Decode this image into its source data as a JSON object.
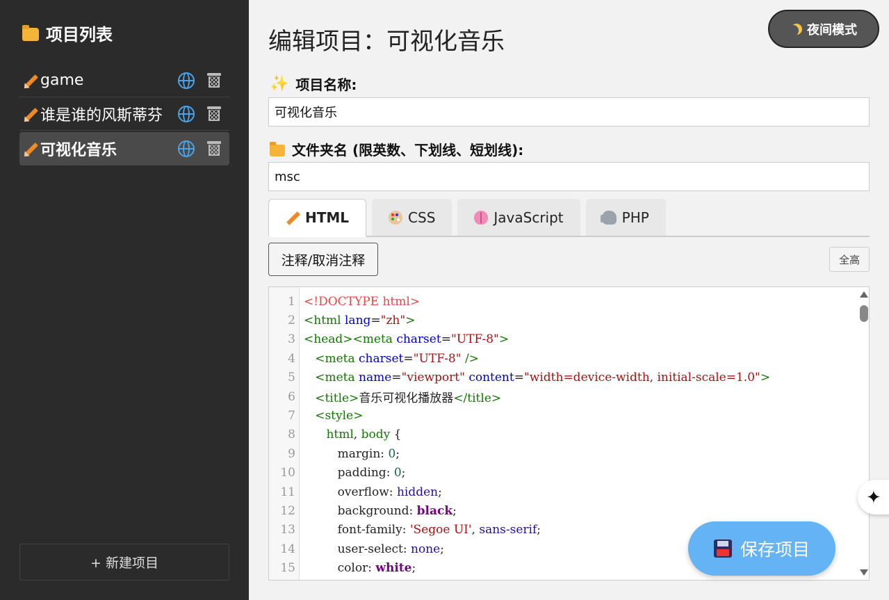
{
  "sidebar": {
    "title": "项目列表",
    "projects": [
      {
        "name": "game"
      },
      {
        "name": "谁是谁的风斯蒂芬"
      },
      {
        "name": "可视化音乐"
      }
    ],
    "new_project": "+ 新建项目"
  },
  "main": {
    "title": "编辑项目：可视化音乐",
    "night_mode": "夜间模式",
    "project_name_label": "项目名称:",
    "project_name_value": "可视化音乐",
    "folder_label": "文件夹名 (限英数、下划线、短划线):",
    "folder_value": "msc",
    "tabs": [
      {
        "label": "HTML",
        "icon": "pencil-icon"
      },
      {
        "label": "CSS",
        "icon": "palette-icon"
      },
      {
        "label": "JavaScript",
        "icon": "brain-icon"
      },
      {
        "label": "PHP",
        "icon": "elephant-icon"
      }
    ],
    "comment_button": "注释/取消注释",
    "full_height_button": "全高",
    "save_button": "保存项目"
  },
  "editor": {
    "lines": [
      {
        "n": "1",
        "tokens": [
          [
            "meta",
            "<!DOCTYPE html>"
          ]
        ]
      },
      {
        "n": "2",
        "tokens": [
          [
            "tag",
            "<html"
          ],
          [
            "plain",
            " "
          ],
          [
            "attr",
            "lang"
          ],
          [
            "plain",
            "="
          ],
          [
            "str",
            "\"zh\""
          ],
          [
            "tag",
            ">"
          ]
        ]
      },
      {
        "n": "3",
        "tokens": [
          [
            "tag",
            "<head><meta"
          ],
          [
            "plain",
            " "
          ],
          [
            "attr",
            "charset"
          ],
          [
            "plain",
            "="
          ],
          [
            "str",
            "\"UTF-8\""
          ],
          [
            "tag",
            ">"
          ]
        ]
      },
      {
        "n": "4",
        "tokens": [
          [
            "plain",
            "   "
          ],
          [
            "tag",
            "<meta"
          ],
          [
            "plain",
            " "
          ],
          [
            "attr",
            "charset"
          ],
          [
            "plain",
            "="
          ],
          [
            "str",
            "\"UTF-8\""
          ],
          [
            "plain",
            " "
          ],
          [
            "tag",
            "/>"
          ]
        ]
      },
      {
        "n": "5",
        "tokens": [
          [
            "plain",
            "   "
          ],
          [
            "tag",
            "<meta"
          ],
          [
            "plain",
            " "
          ],
          [
            "attr",
            "name"
          ],
          [
            "plain",
            "="
          ],
          [
            "str",
            "\"viewport\""
          ],
          [
            "plain",
            " "
          ],
          [
            "attr",
            "content"
          ],
          [
            "plain",
            "="
          ],
          [
            "str",
            "\"width=device-width, initial-scale=1.0\""
          ],
          [
            "tag",
            ">"
          ]
        ]
      },
      {
        "n": "6",
        "tokens": [
          [
            "plain",
            "   "
          ],
          [
            "tag",
            "<title>"
          ],
          [
            "plain",
            "音乐可视化播放器"
          ],
          [
            "tag",
            "</title>"
          ]
        ]
      },
      {
        "n": "7",
        "tokens": [
          [
            "plain",
            "   "
          ],
          [
            "tag",
            "<style>"
          ]
        ]
      },
      {
        "n": "8",
        "tokens": [
          [
            "plain",
            "      "
          ],
          [
            "tag",
            "html"
          ],
          [
            "plain",
            ", "
          ],
          [
            "tag",
            "body"
          ],
          [
            "plain",
            " {"
          ]
        ]
      },
      {
        "n": "9",
        "tokens": [
          [
            "plain",
            "         "
          ],
          [
            "prop",
            "margin"
          ],
          [
            "plain",
            ": "
          ],
          [
            "num",
            "0"
          ],
          [
            "plain",
            ";"
          ]
        ]
      },
      {
        "n": "10",
        "tokens": [
          [
            "plain",
            "         "
          ],
          [
            "prop",
            "padding"
          ],
          [
            "plain",
            ": "
          ],
          [
            "num",
            "0"
          ],
          [
            "plain",
            ";"
          ]
        ]
      },
      {
        "n": "11",
        "tokens": [
          [
            "plain",
            "         "
          ],
          [
            "prop",
            "overflow"
          ],
          [
            "plain",
            ": "
          ],
          [
            "atom",
            "hidden"
          ],
          [
            "plain",
            ";"
          ]
        ]
      },
      {
        "n": "12",
        "tokens": [
          [
            "plain",
            "         "
          ],
          [
            "prop",
            "background"
          ],
          [
            "plain",
            ": "
          ],
          [
            "kw",
            "black"
          ],
          [
            "plain",
            ";"
          ]
        ]
      },
      {
        "n": "13",
        "tokens": [
          [
            "plain",
            "         "
          ],
          [
            "prop",
            "font-family"
          ],
          [
            "plain",
            ": "
          ],
          [
            "strq",
            "'Segoe UI'"
          ],
          [
            "plain",
            ", "
          ],
          [
            "atom",
            "sans-serif"
          ],
          [
            "plain",
            ";"
          ]
        ]
      },
      {
        "n": "14",
        "tokens": [
          [
            "plain",
            "         "
          ],
          [
            "prop",
            "user-select"
          ],
          [
            "plain",
            ": "
          ],
          [
            "atom",
            "none"
          ],
          [
            "plain",
            ";"
          ]
        ]
      },
      {
        "n": "15",
        "tokens": [
          [
            "plain",
            "         "
          ],
          [
            "prop",
            "color"
          ],
          [
            "plain",
            ": "
          ],
          [
            "kw",
            "white"
          ],
          [
            "plain",
            ";"
          ]
        ]
      }
    ]
  }
}
